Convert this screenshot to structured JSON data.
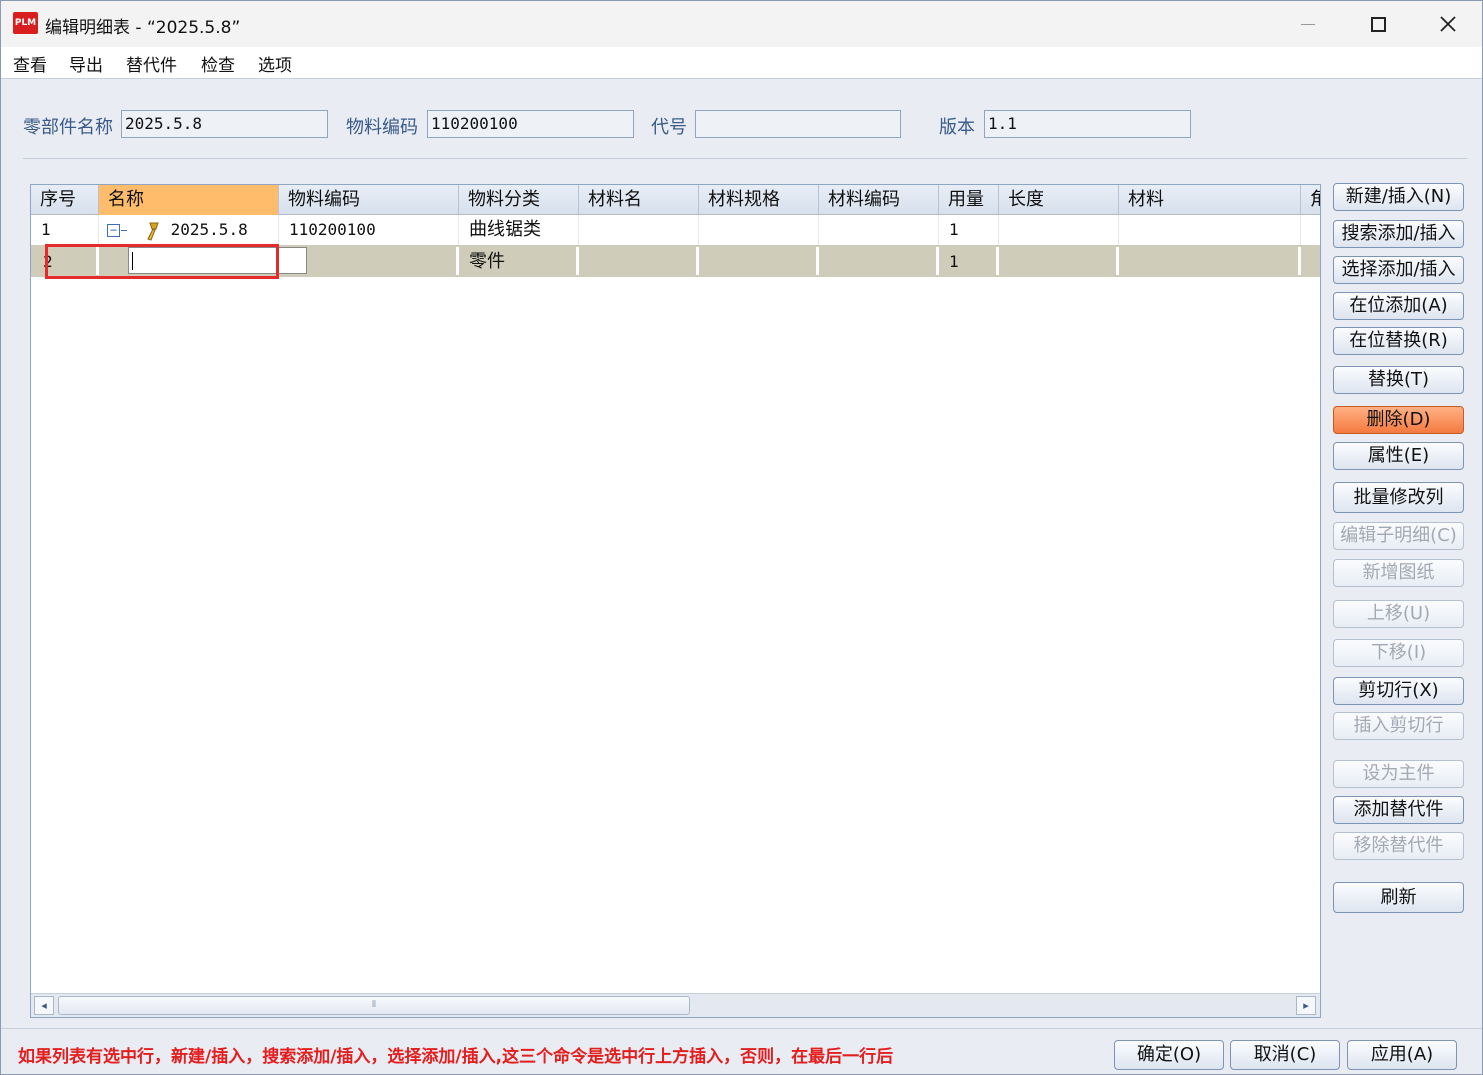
{
  "window": {
    "app_logo": "PLM",
    "title": "编辑明细表 - “2025.5.8”"
  },
  "menu": [
    "查看",
    "导出",
    "替代件",
    "检查",
    "选项"
  ],
  "form": {
    "part_name_label": "零部件名称",
    "part_name_value": "2025.5.8",
    "material_code_label": "物料编码",
    "material_code_value": "110200100",
    "code_label": "代号",
    "code_value": "",
    "version_label": "版本",
    "version_value": "1.1"
  },
  "table": {
    "columns": [
      "序号",
      "名称",
      "物料编码",
      "物料分类",
      "材料名",
      "材料规格",
      "材料编码",
      "用量",
      "长度",
      "材料",
      "角"
    ],
    "active_column": "名称",
    "rows": [
      {
        "seq": "1",
        "name": "2025.5.8",
        "material_code": "110200100",
        "category": "曲线锯类",
        "mat_name": "",
        "mat_spec": "",
        "mat_code": "",
        "qty": "1",
        "length": "",
        "material": ""
      },
      {
        "seq": "2",
        "name": "",
        "material_code": "",
        "category": "零件",
        "mat_name": "",
        "mat_spec": "",
        "mat_code": "",
        "qty": "1",
        "length": "",
        "material": ""
      }
    ],
    "scroll_thumb_glyph": "⦀"
  },
  "side_buttons": [
    {
      "label": "新建/插入(N)",
      "state": "enabled"
    },
    {
      "label": "搜索添加/插入",
      "state": "enabled"
    },
    {
      "label": "选择添加/插入",
      "state": "enabled"
    },
    {
      "label": "在位添加(A)",
      "state": "enabled"
    },
    {
      "label": "在位替换(R)",
      "state": "enabled"
    },
    {
      "label": "替换(T)",
      "state": "enabled"
    },
    {
      "label": "删除(D)",
      "state": "danger"
    },
    {
      "label": "属性(E)",
      "state": "enabled"
    },
    {
      "label": "批量修改列",
      "state": "enabled"
    },
    {
      "label": "编辑子明细(C)",
      "state": "disabled"
    },
    {
      "label": "新增图纸",
      "state": "disabled"
    },
    {
      "label": "上移(U)",
      "state": "disabled"
    },
    {
      "label": "下移(I)",
      "state": "disabled"
    },
    {
      "label": "剪切行(X)",
      "state": "enabled"
    },
    {
      "label": "插入剪切行",
      "state": "disabled"
    },
    {
      "label": "设为主件",
      "state": "disabled"
    },
    {
      "label": "添加替代件",
      "state": "enabled"
    },
    {
      "label": "移除替代件",
      "state": "disabled"
    },
    {
      "label": "刷新",
      "state": "enabled"
    }
  ],
  "hint": "如果列表有选中行，新建/插入，搜索添加/插入，选择添加/插入,这三个命令是选中行上方插入，否则，在最后一行后",
  "bottom_buttons": {
    "ok": "确定(O)",
    "cancel": "取消(C)",
    "apply": "应用(A)"
  },
  "colors": {
    "active_header": "#ffbd6b",
    "selected_row": "#cfcdb9",
    "danger_button": "#f47a3f",
    "hint_text": "#e31e1e",
    "highlight_box": "#e52b2b"
  }
}
